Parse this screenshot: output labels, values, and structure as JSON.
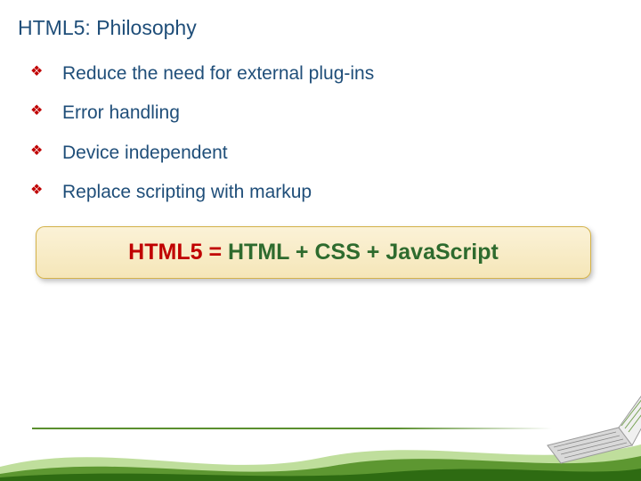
{
  "title": "HTML5: Philosophy",
  "bullets": [
    "Reduce the need for external plug-ins",
    "Error handling",
    "Device independent",
    "Replace scripting with markup"
  ],
  "highlight": {
    "lead": "HTML5 = ",
    "rest": "HTML + CSS + JavaScript"
  },
  "colors": {
    "title": "#1f4e79",
    "bullet_marker": "#c00000",
    "highlight_lead": "#c00000",
    "highlight_rest": "#2e6b2e",
    "accent_green": "#5a8f2e"
  }
}
